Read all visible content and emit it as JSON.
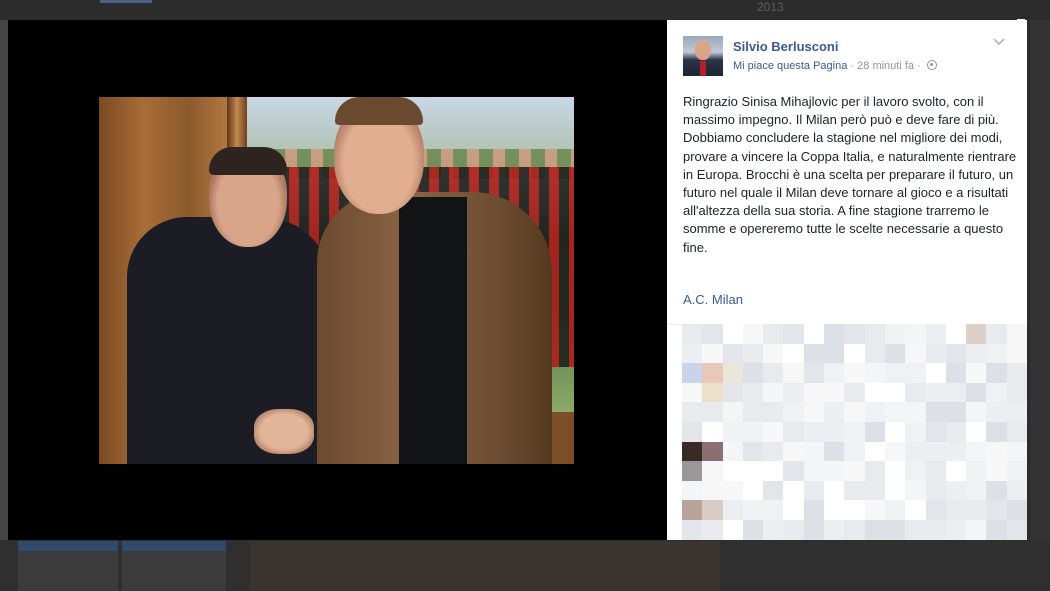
{
  "background": {
    "year_text": "2013"
  },
  "post": {
    "author": "Silvio Berlusconi",
    "like_page": "Mi piace questa Pagina",
    "separator": "·",
    "time": "28 minuti fa",
    "separator2": "·",
    "text": "Ringrazio Sinisa Mihajlovic per il lavoro svolto, con il massimo impegno. Il Milan però può e deve fare di più. Dobbiamo concludere la stagione nel migliore dei modi, provare a vincere la Coppa Italia, e naturalmente rientrare in Europa. Brocchi è una scelta per preparare il futuro, un futuro nel quale il Milan deve tornare al gioco e a risultati all'altezza della sua storia. A fine stagione trarremo le somme e opereremo tutte le scelte necessarie a questo fine.",
    "tag": "A.C. Milan"
  },
  "icons": {
    "globe": "globe-icon",
    "chevron": "chevron-down-icon"
  },
  "colors": {
    "link": "#3b5998",
    "meta": "#90949c",
    "text": "#1d2129",
    "stage": "#000000"
  }
}
